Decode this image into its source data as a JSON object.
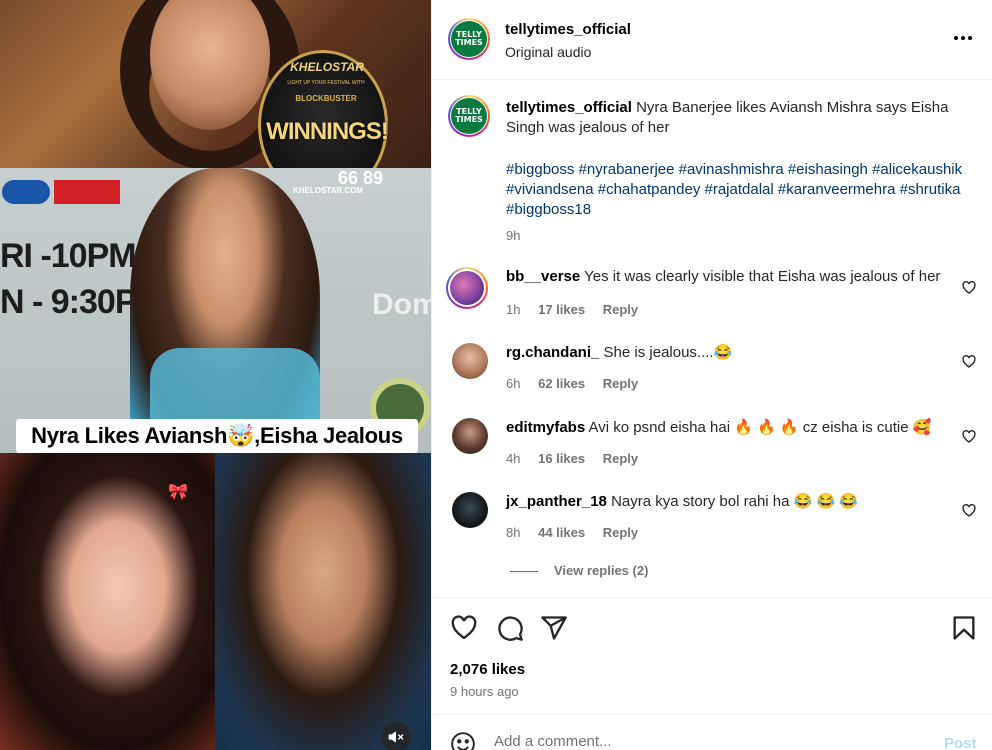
{
  "media": {
    "badge": {
      "brand": "KHELOSTAR",
      "tagline": "LIGHT UP YOUR FESTIVAL WITH",
      "blockbuster": "BLOCKBUSTER",
      "winnings": "WINNINGS!",
      "site": "KHELOSTAR.COM"
    },
    "timing_lines": [
      "RI -10PM",
      "N - 9:30PM"
    ],
    "number_sign": "66 89",
    "brand_corner": "Dom",
    "caption_overlay": "Nyra Likes Aviansh🤯,Eisha Jealous",
    "mute_icon": "speaker-muted-icon"
  },
  "post": {
    "username": "tellytimes_official",
    "audio": "Original audio",
    "logo_text": "TELLY TIMES",
    "caption_user": "tellytimes_official",
    "caption_text": "Nyra Banerjee likes Aviansh Mishra says Eisha Singh was jealous of her",
    "hashtags": "#biggboss #nyrabanerjee #avinashmishra #eishasingh #alicekaushik #viviandsena #chahatpandey #rajatdalal #karanveermehra #shrutika #biggboss18",
    "caption_time": "9h"
  },
  "comments": [
    {
      "user": "bb__verse",
      "text": "Yes it was clearly visible that Eisha was jealous of her",
      "time": "1h",
      "likes": "17 likes",
      "reply": "Reply"
    },
    {
      "user": "rg.chandani_",
      "text": "She is jealous....😂",
      "time": "6h",
      "likes": "62 likes",
      "reply": "Reply"
    },
    {
      "user": "editmyfabs",
      "text": "Avi ko psnd eisha hai 🔥 🔥 🔥 cz eisha is cutie 🥰",
      "time": "4h",
      "likes": "16 likes",
      "reply": "Reply"
    },
    {
      "user": "jx_panther_18",
      "text": "Nayra kya story bol rahi ha 😂 😂 😂",
      "time": "8h",
      "likes": "44 likes",
      "reply": "Reply"
    }
  ],
  "view_replies": "View replies (2)",
  "actions": {
    "likes": "2,076 likes",
    "posted": "9 hours ago"
  },
  "add_comment": {
    "placeholder": "Add a comment...",
    "post_label": "Post"
  },
  "colors": {
    "link": "#00376b",
    "secondary_text": "#737373",
    "post_disabled": "#b3dbff",
    "logo_green": "#0b7a3e"
  }
}
